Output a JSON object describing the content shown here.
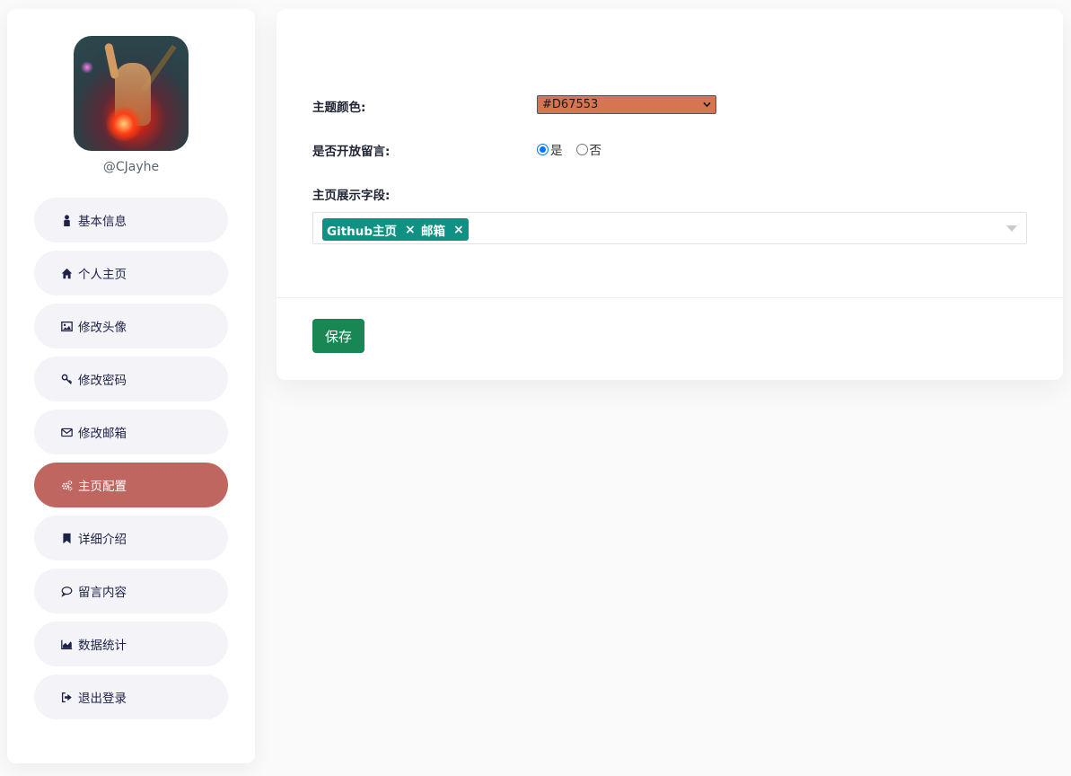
{
  "sidebar": {
    "username": "@CJayhe",
    "items": [
      {
        "label": "基本信息",
        "icon": "user-icon"
      },
      {
        "label": "个人主页",
        "icon": "home-icon"
      },
      {
        "label": "修改头像",
        "icon": "image-icon"
      },
      {
        "label": "修改密码",
        "icon": "key-icon"
      },
      {
        "label": "修改邮箱",
        "icon": "envelope-icon"
      },
      {
        "label": "主页配置",
        "icon": "cogs-icon",
        "active": true
      },
      {
        "label": "详细介绍",
        "icon": "bookmark-icon"
      },
      {
        "label": "留言内容",
        "icon": "comment-icon"
      },
      {
        "label": "数据统计",
        "icon": "area-chart-icon"
      },
      {
        "label": "退出登录",
        "icon": "sign-out-icon"
      }
    ],
    "active_color": "#c06660"
  },
  "form": {
    "theme_color_label": "主题颜色:",
    "theme_color_value": "#D67553",
    "theme_color_swatch": "#D67553",
    "comments_label": "是否开放留言:",
    "comments_options": [
      "是",
      "否"
    ],
    "comments_selected": "是",
    "fields_label": "主页展示字段:",
    "fields_selected": [
      "Github主页",
      "邮箱"
    ],
    "tag_color": "#0f9283",
    "tag_remove": "×",
    "save_label": "保存",
    "save_color": "#198754"
  }
}
